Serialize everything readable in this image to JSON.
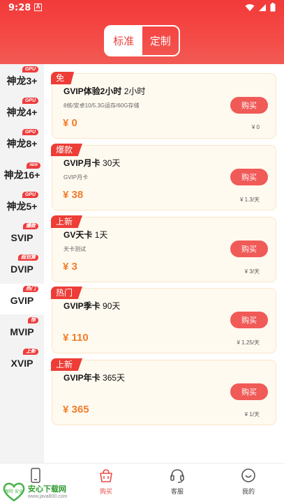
{
  "status_bar": {
    "time": "9:28",
    "notification_letter": "A"
  },
  "segment": {
    "tabs": [
      {
        "label": "标准",
        "active": true
      },
      {
        "label": "定制",
        "active": false
      }
    ]
  },
  "sidebar": {
    "items": [
      {
        "label": "神龙3+",
        "badge": "GPU",
        "active": false
      },
      {
        "label": "神龙4+",
        "badge": "GPU",
        "active": false
      },
      {
        "label": "神龙8+",
        "badge": "GPU",
        "active": false
      },
      {
        "label": "神龙16+",
        "badge": "NEW",
        "active": false
      },
      {
        "label": "神龙5+",
        "badge": "GPU",
        "active": false
      },
      {
        "label": "SVIP",
        "badge": "爆款",
        "active": false
      },
      {
        "label": "DVIP",
        "badge": "超划算",
        "active": false
      },
      {
        "label": "GVIP",
        "badge": "热门",
        "active": true
      },
      {
        "label": "MVIP",
        "badge": "惊",
        "active": false
      },
      {
        "label": "XVIP",
        "badge": "上新",
        "active": false
      }
    ]
  },
  "cards": [
    {
      "tag": "免",
      "name": "GVIP体验2小时",
      "duration": "2小时",
      "desc": "8核/安卓10/5.3G运存/60G存储",
      "price": "¥ 0",
      "unit_price": "¥ 0",
      "buy_label": "购买"
    },
    {
      "tag": "爆款",
      "name": "GVIP月卡",
      "duration": "30天",
      "desc": "GVIP月卡",
      "price": "¥ 38",
      "unit_price": "¥ 1.3/天",
      "buy_label": "购买"
    },
    {
      "tag": "上新",
      "name": "GV天卡",
      "duration": "1天",
      "desc": "天卡测试",
      "price": "¥ 3",
      "unit_price": "¥ 3/天",
      "buy_label": "购买"
    },
    {
      "tag": "热门",
      "name": "GVIP季卡",
      "duration": "90天",
      "desc": "",
      "price": "¥ 110",
      "unit_price": "¥ 1.25/天",
      "buy_label": "购买"
    },
    {
      "tag": "上新",
      "name": "GVIP年卡",
      "duration": "365天",
      "desc": "",
      "price": "¥ 365",
      "unit_price": "¥ 1/天",
      "buy_label": "购买"
    }
  ],
  "bottom_nav": {
    "items": [
      {
        "label": "",
        "icon": "phone-icon",
        "active": false
      },
      {
        "label": "购买",
        "icon": "basket-icon",
        "active": true
      },
      {
        "label": "客服",
        "icon": "headset-icon",
        "active": false
      },
      {
        "label": "我的",
        "icon": "profile-icon",
        "active": false
      }
    ]
  },
  "watermark": {
    "name": "安心下载网",
    "url": "www.java800.com",
    "logo_text": "保险 安全"
  },
  "colors": {
    "primary_red": "#f23a3a",
    "price_orange": "#f07d2a",
    "buy_button": "#f05a57",
    "card_bg": "#fffaf0"
  }
}
